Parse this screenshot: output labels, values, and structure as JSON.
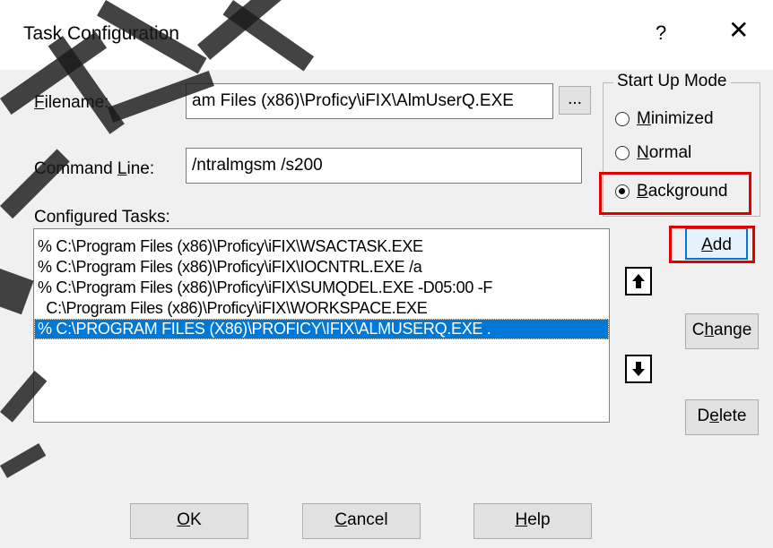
{
  "dialog": {
    "title": "Task Configuration",
    "help_glyph": "?",
    "close_glyph": "✕"
  },
  "filename": {
    "label": "Filename:",
    "value": "am Files (x86)\\Proficy\\iFIX\\AlmUserQ.EXE",
    "browse_label": "..."
  },
  "command_line": {
    "label": "Command Line:",
    "value": "/ntralmgsm /s200"
  },
  "start_up_mode": {
    "legend": "Start Up Mode",
    "options": [
      {
        "label": "Minimized",
        "checked": false
      },
      {
        "label": "Normal",
        "checked": false
      },
      {
        "label": "Background",
        "checked": true
      }
    ]
  },
  "configured_tasks": {
    "label": "Configured Tasks:",
    "rows": [
      "% C:\\Program Files (x86)\\Proficy\\iFIX\\WSACTASK.EXE",
      "% C:\\Program Files (x86)\\Proficy\\iFIX\\IOCNTRL.EXE   /a",
      "% C:\\Program Files (x86)\\Proficy\\iFIX\\SUMQDEL.EXE   -D05:00 -F",
      "  C:\\Program Files (x86)\\Proficy\\iFIX\\WORKSPACE.EXE",
      "% C:\\PROGRAM FILES (X86)\\PROFICY\\IFIX\\ALMUSERQ.EXE  ."
    ],
    "selected_index": 4
  },
  "side_buttons": {
    "add": "Add",
    "change": "Change",
    "delete": "Delete"
  },
  "footer_buttons": {
    "ok": "OK",
    "cancel": "Cancel",
    "help": "Help"
  },
  "colors": {
    "selection": "#0078d7",
    "highlight_box": "#e00000",
    "dialog_bg": "#f0f0f0"
  }
}
